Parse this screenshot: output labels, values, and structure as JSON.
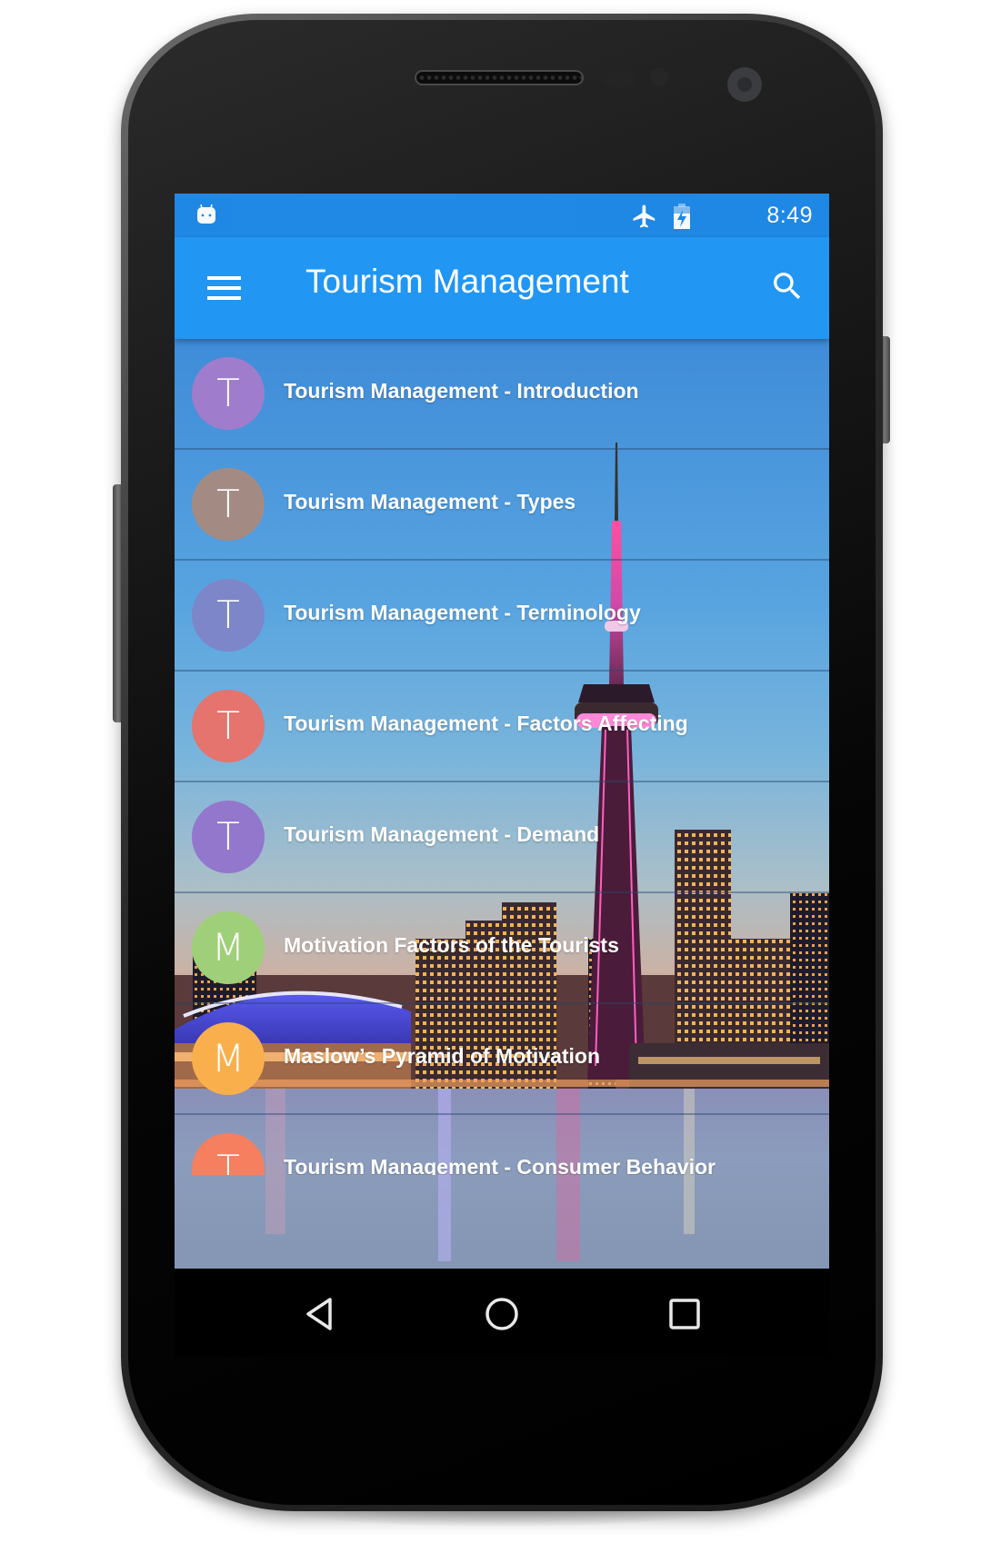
{
  "device": {
    "status_bar": {
      "notification_icon": "android-debug-icon",
      "icons": [
        "airplane-mode-icon",
        "battery-charging-icon"
      ],
      "time": "8:49"
    },
    "nav_bar": {
      "buttons": [
        "back",
        "home",
        "recents"
      ]
    }
  },
  "app_bar": {
    "title": "Tourism Management",
    "left_icon": "menu-icon",
    "right_icon": "search-icon"
  },
  "colors": {
    "status_bar": "#1f88e5",
    "app_bar": "#2196f3"
  },
  "list": {
    "items": [
      {
        "initial": "T",
        "title": "Tourism Management - Introduction",
        "color": "#a07ccc"
      },
      {
        "initial": "T",
        "title": "Tourism Management - Types",
        "color": "#a38b84"
      },
      {
        "initial": "T",
        "title": "Tourism Management - Terminology",
        "color": "#7d86c8"
      },
      {
        "initial": "T",
        "title": "Tourism Management - Factors Affecting",
        "color": "#e5736e"
      },
      {
        "initial": "T",
        "title": "Tourism Management - Demand",
        "color": "#9377cc"
      },
      {
        "initial": "M",
        "title": "Motivation Factors of the Tourists",
        "color": "#9fcf78"
      },
      {
        "initial": "M",
        "title": "Maslow’s Pyramid of Motivation",
        "color": "#f9b04c"
      },
      {
        "initial": "T",
        "title": "Tourism Management - Consumer Behavior",
        "color": "#f57f5e"
      }
    ]
  }
}
